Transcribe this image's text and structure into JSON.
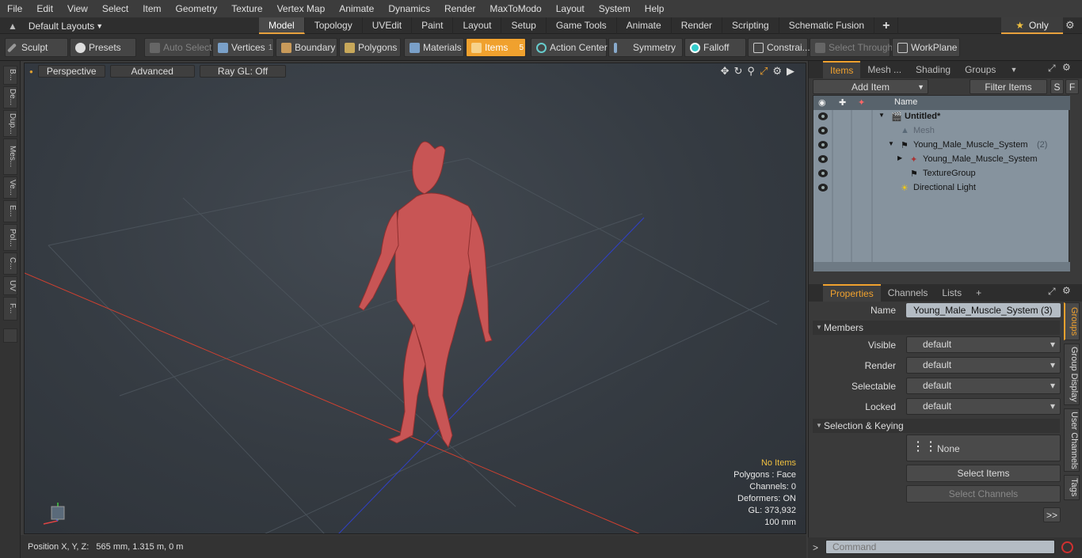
{
  "menu": [
    "File",
    "Edit",
    "View",
    "Select",
    "Item",
    "Geometry",
    "Texture",
    "Vertex Map",
    "Animate",
    "Dynamics",
    "Render",
    "MaxToModo",
    "Layout",
    "System",
    "Help"
  ],
  "layout_dropdown": "Default Layouts",
  "mode_tabs": [
    {
      "label": "Model",
      "active": true
    },
    {
      "label": "Topology"
    },
    {
      "label": "UVEdit"
    },
    {
      "label": "Paint"
    },
    {
      "label": "Layout"
    },
    {
      "label": "Setup"
    },
    {
      "label": "Game Tools"
    },
    {
      "label": "Animate"
    },
    {
      "label": "Render"
    },
    {
      "label": "Scripting"
    },
    {
      "label": "Schematic Fusion"
    }
  ],
  "mode_plus": "+",
  "only_label": "Only",
  "toolbar": {
    "sculpt": "Sculpt",
    "presets": "Presets",
    "auto_select": "Auto Select",
    "vertices": "Vertices",
    "vertices_count": "1",
    "boundary": "Boundary",
    "polygons": "Polygons",
    "materials": "Materials",
    "items": "Items",
    "items_count": "5",
    "action_center": "Action Center",
    "symmetry": "Symmetry",
    "falloff": "Falloff",
    "constraints": "Constrai...",
    "select_through": "Select Through",
    "workplane": "WorkPlane"
  },
  "left_tabs": [
    "B...",
    "De...",
    "Dup...",
    "Mes...",
    "Ve...",
    "E...",
    "Pol...",
    "C...",
    "UV",
    "F..."
  ],
  "viewport": {
    "perspective": "Perspective",
    "advanced": "Advanced",
    "raygl": "Ray GL: Off",
    "info": {
      "no_items": "No Items",
      "polygons": "Polygons : Face",
      "channels": "Channels: 0",
      "deformers": "Deformers: ON",
      "gl": "GL: 373,932",
      "scale": "100 mm"
    }
  },
  "status": "Position X, Y, Z:   565 mm, 1.315 m, 0 m",
  "items_panel": {
    "tabs": [
      {
        "label": "Items",
        "active": true
      },
      {
        "label": "Mesh ..."
      },
      {
        "label": "Shading"
      },
      {
        "label": "Groups"
      }
    ],
    "add_item": "Add Item",
    "filter": "Filter Items",
    "s": "S",
    "f": "F",
    "col_name": "Name",
    "rows": [
      {
        "name": "Untitled*",
        "bold": true
      },
      {
        "name": "Mesh",
        "dim": true
      },
      {
        "name": "Young_Male_Muscle_System",
        "suffix": "(2)"
      },
      {
        "name": "Young_Male_Muscle_System"
      },
      {
        "name": "TextureGroup"
      },
      {
        "name": "Directional Light"
      }
    ]
  },
  "props_panel": {
    "tabs": [
      {
        "label": "Properties",
        "active": true
      },
      {
        "label": "Channels"
      },
      {
        "label": "Lists"
      },
      {
        "label": "+"
      }
    ],
    "name_label": "Name",
    "name_value": "Young_Male_Muscle_System (3)",
    "members": "Members",
    "fields": [
      {
        "label": "Visible",
        "value": "default"
      },
      {
        "label": "Render",
        "value": "default"
      },
      {
        "label": "Selectable",
        "value": "default"
      },
      {
        "label": "Locked",
        "value": "default"
      }
    ],
    "sel_keying": "Selection & Keying",
    "none": "None",
    "select_items": "Select Items",
    "select_channels": "Select Channels",
    "more": ">>",
    "vtabs": [
      "Groups",
      "Group Display",
      "User Channels",
      "Tags"
    ]
  },
  "command_placeholder": "Command"
}
